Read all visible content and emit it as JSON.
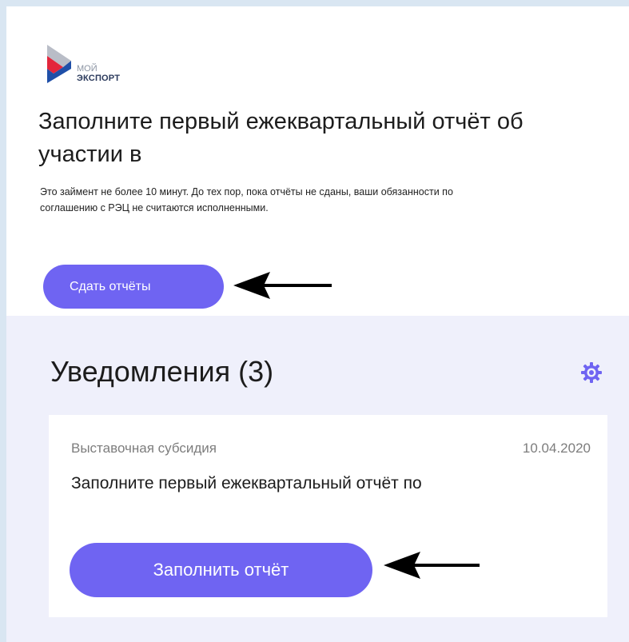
{
  "logo": {
    "line1": "МОЙ",
    "line2": "ЭКСПОРТ"
  },
  "top": {
    "title": "Заполните первый ежеквартальный отчёт об участии в",
    "description": "Это займент не более 10 минут. До тех пор, пока отчёты не сданы, ваши обязанности по соглашению с РЭЦ не считаются исполненными.",
    "button_label": "Сдать отчёты"
  },
  "notifications": {
    "title": "Уведомления (3)",
    "card": {
      "category": "Выставочная субсидия",
      "date": "10.04.2020",
      "text": "Заполните первый ежеквартальный отчёт по",
      "button_label": "Заполнить отчёт"
    }
  },
  "colors": {
    "accent": "#6f64f2",
    "panel_bg": "#eff0fb",
    "logo_red": "#e3263c",
    "logo_blue": "#1f4fa8"
  },
  "icons": [
    "logo-mark-icon",
    "arrow-left-icon",
    "gear-icon"
  ]
}
